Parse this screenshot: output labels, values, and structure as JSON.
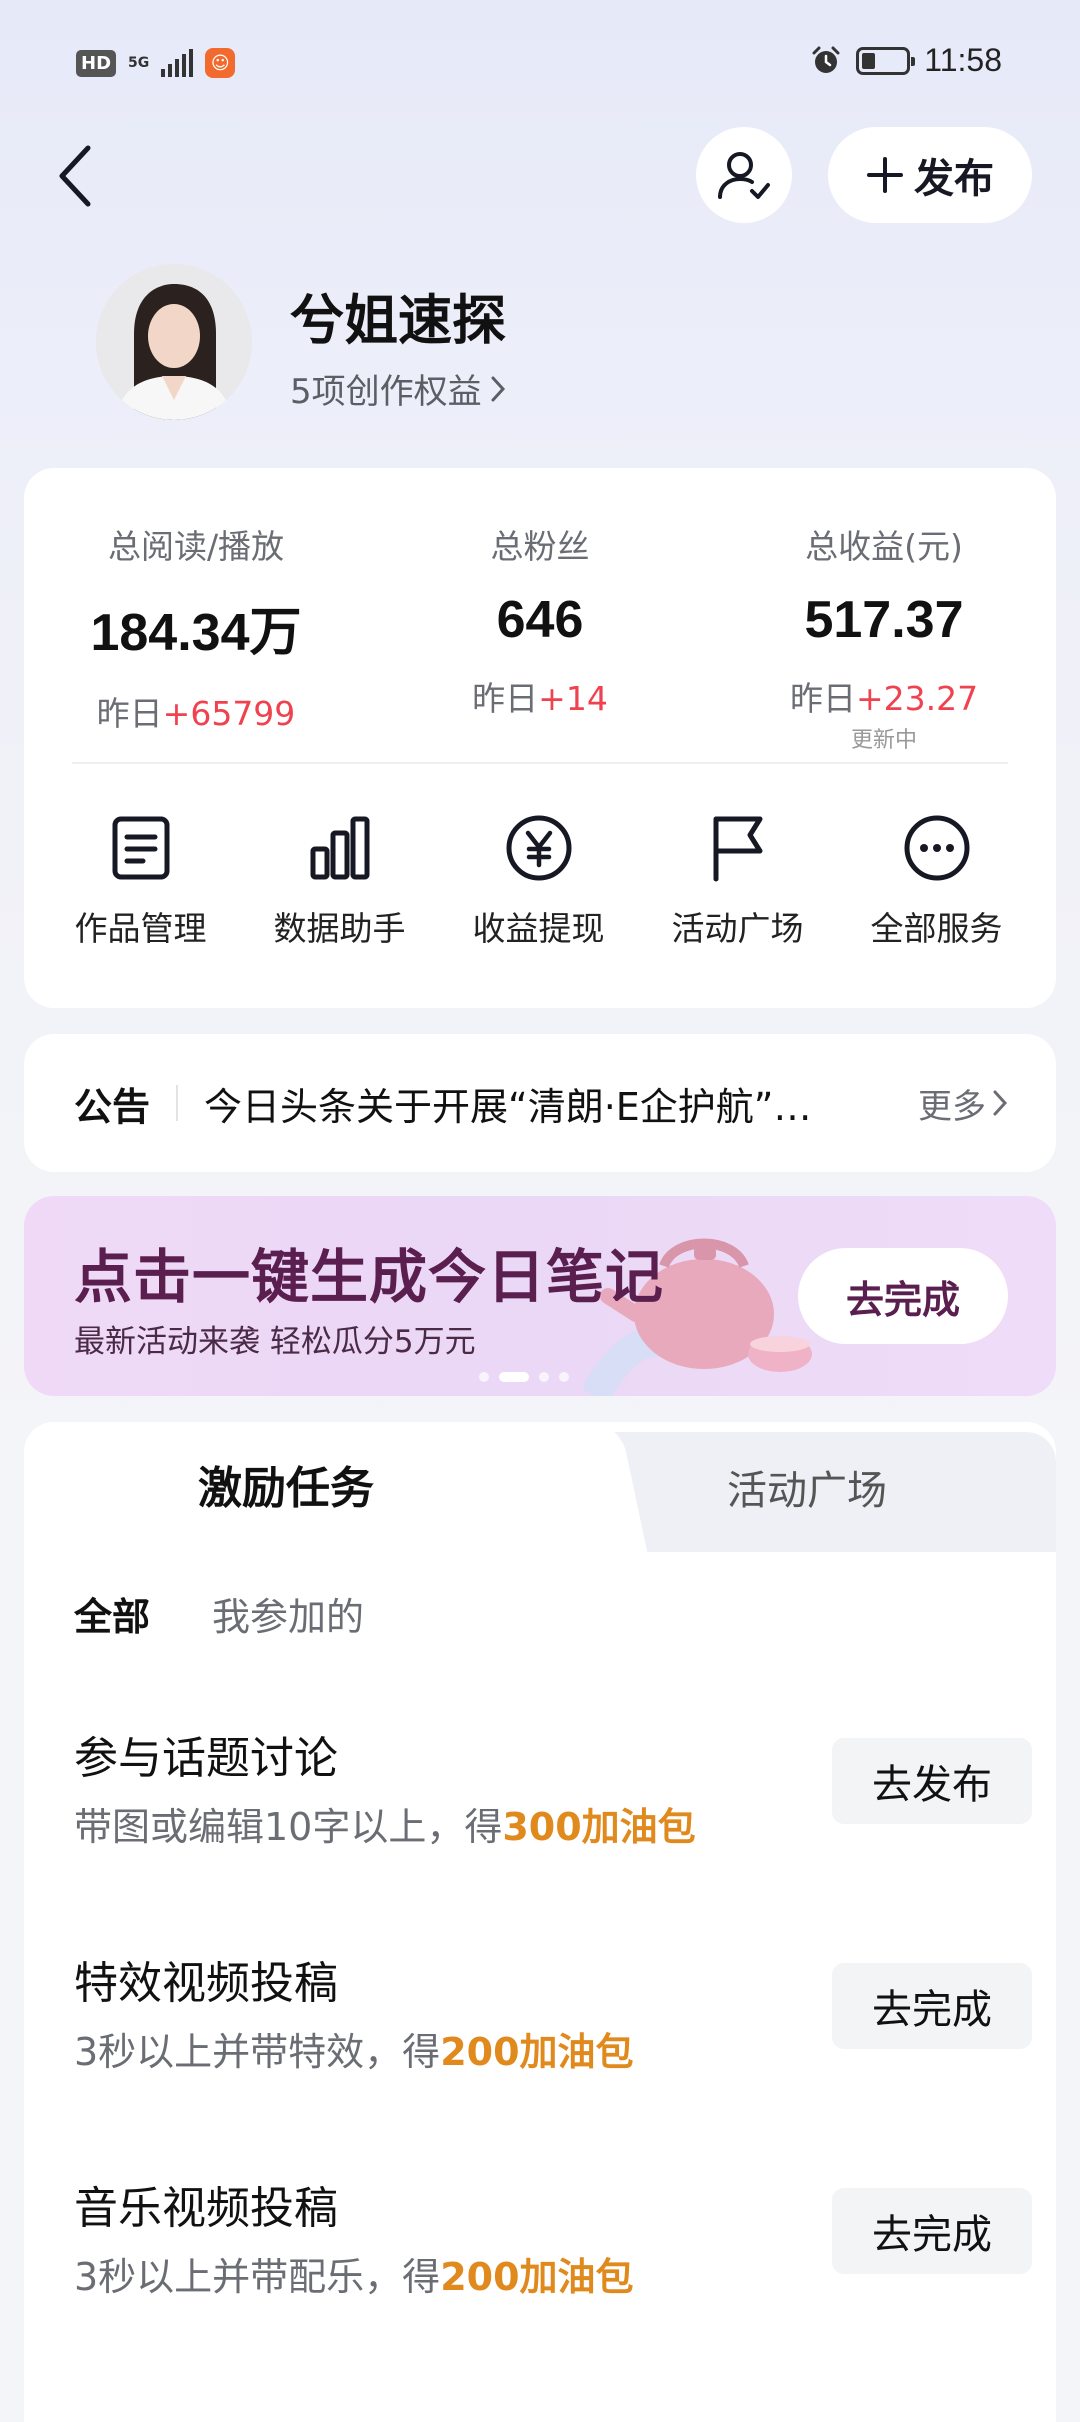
{
  "status_bar": {
    "hd": "HD",
    "network": "5G",
    "time": "11:58",
    "battery_level": 0.3
  },
  "header": {
    "publish_label": "发布"
  },
  "profile": {
    "name": "兮姐速探",
    "rights": "5项创作权益"
  },
  "stats": [
    {
      "label": "总阅读/播放",
      "value": "184.34万",
      "delta_prefix": "昨日",
      "delta": "+65799",
      "note": ""
    },
    {
      "label": "总粉丝",
      "value": "646",
      "delta_prefix": "昨日",
      "delta": "+14",
      "note": ""
    },
    {
      "label": "总收益(元)",
      "value": "517.37",
      "delta_prefix": "昨日",
      "delta": "+23.27",
      "note": "更新中"
    }
  ],
  "services": [
    {
      "label": "作品管理",
      "icon": "document-icon"
    },
    {
      "label": "数据助手",
      "icon": "bar-chart-icon"
    },
    {
      "label": "收益提现",
      "icon": "yuan-icon"
    },
    {
      "label": "活动广场",
      "icon": "flag-icon"
    },
    {
      "label": "全部服务",
      "icon": "more-icon"
    }
  ],
  "notice": {
    "tag": "公告",
    "text": "今日头条关于开展“清朗·E企护航”…",
    "more": "更多"
  },
  "banner": {
    "title": "点击一键生成今日笔记",
    "subtitle": "最新活动来袭 轻松瓜分5万元",
    "cta": "去完成",
    "page_count": 4,
    "active_index": 1
  },
  "tasks": {
    "tabs": [
      "激励任务",
      "活动广场"
    ],
    "filters": [
      "全部",
      "我参加的"
    ],
    "items": [
      {
        "title": "参与话题讨论",
        "desc": "带图或编辑10字以上，得",
        "reward": "300加油包",
        "button": "去发布"
      },
      {
        "title": "特效视频投稿",
        "desc": "3秒以上并带特效，得",
        "reward": "200加油包",
        "button": "去完成"
      },
      {
        "title": "音乐视频投稿",
        "desc": "3秒以上并带配乐，得",
        "reward": "200加油包",
        "button": "去完成"
      }
    ]
  },
  "colors": {
    "accent_red": "#f0414f",
    "reward_orange": "#e08a1e",
    "banner_text": "#5a1f4f"
  }
}
